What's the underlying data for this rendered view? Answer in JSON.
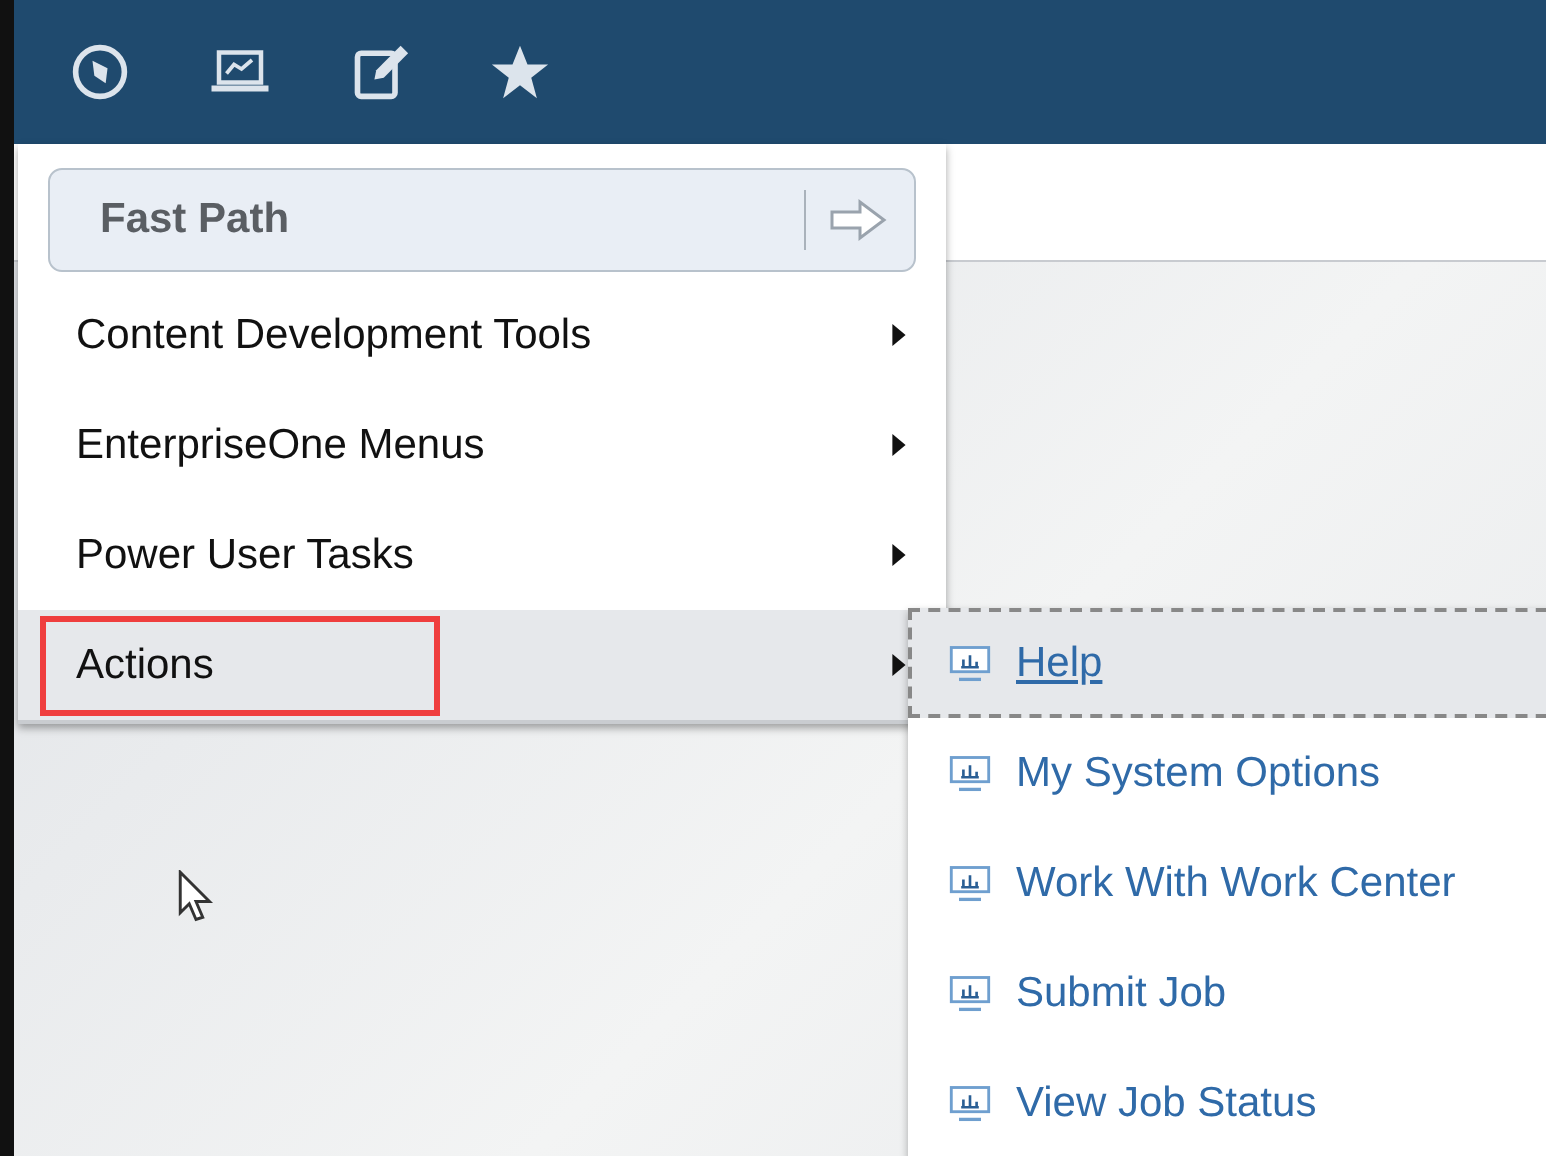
{
  "toolbar": {
    "icons": [
      {
        "kind": "compass"
      },
      {
        "kind": "monitor"
      },
      {
        "kind": "edit"
      },
      {
        "kind": "star"
      }
    ]
  },
  "menu": {
    "fast_path": {
      "placeholder": "Fast Path"
    },
    "items": [
      {
        "label": "Content Development Tools",
        "highlighted": false,
        "annotated": false
      },
      {
        "label": "EnterpriseOne Menus",
        "highlighted": false,
        "annotated": false
      },
      {
        "label": "Power User Tasks",
        "highlighted": false,
        "annotated": false
      },
      {
        "label": "Actions",
        "highlighted": true,
        "annotated": true
      }
    ]
  },
  "submenu": {
    "items": [
      {
        "label": "Help",
        "focused": true
      },
      {
        "label": "My System Options",
        "focused": false
      },
      {
        "label": "Work With Work Center",
        "focused": false
      },
      {
        "label": "Submit Job",
        "focused": false
      },
      {
        "label": "View Job Status",
        "focused": false
      }
    ]
  }
}
